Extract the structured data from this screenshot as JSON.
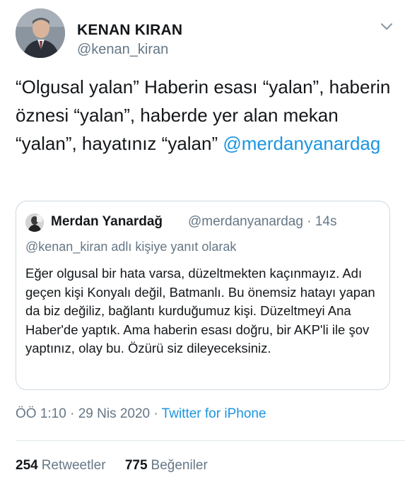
{
  "author": {
    "name": "KENAN KIRAN",
    "handle": "@kenan_kiran"
  },
  "tweet": {
    "text": "“Olgusal yalan” Haberin esası “yalan”, haberin öznesi “yalan”, haberde yer alan mekan “yalan”, hayatınız “yalan”",
    "mention": "@merdanyanardag"
  },
  "quoted": {
    "name": "Merdan Yanardağ",
    "handle_time": "@merdanyanardag · 14s",
    "reply_context": "@kenan_kiran adlı kişiye yanıt olarak",
    "text": "Eğer olgusal bir hata varsa, düzeltmekten kaçınmayız. Adı geçen kişi Konyalı değil, Batmanlı. Bu önemsiz hatayı yapan da biz değiliz, bağlantı kurduğumuz kişi. Düzeltmeyi Ana Haber'de yaptık. Ama haberin esası doğru, bir AKP'li ile şov yaptınız, olay bu. Özürü siz dileyeceksiniz."
  },
  "meta": {
    "time": "ÖÖ 1:10",
    "date": "29 Nis 2020",
    "separator": "·",
    "source": "Twitter for iPhone"
  },
  "stats": {
    "retweets_count": "254",
    "retweets_label": "Retweetler",
    "likes_count": "775",
    "likes_label": "Beğeniler"
  },
  "colors": {
    "link": "#1b95e0",
    "secondary_text": "#657786",
    "primary_text": "#14171a",
    "border": "#cfd9de"
  },
  "icons": {
    "menu": "chevron-down-icon"
  }
}
